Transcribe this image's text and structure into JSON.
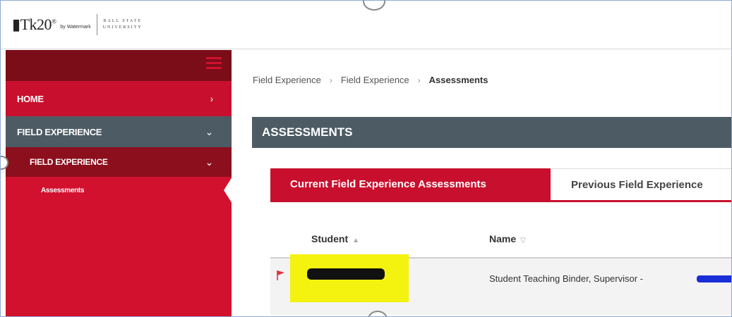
{
  "header": {
    "logo_main": "Tk20",
    "logo_by": "by Watermark",
    "university_line1": "BALL STATE",
    "university_line2": "UNIVERSITY"
  },
  "sidebar": {
    "items": [
      {
        "label": "HOME"
      },
      {
        "label": "FIELD EXPERIENCE"
      },
      {
        "label": "FIELD EXPERIENCE"
      },
      {
        "label": "Assessments"
      }
    ]
  },
  "breadcrumb": [
    "Field Experience",
    "Field Experience",
    "Assessments"
  ],
  "section": {
    "title": "ASSESSMENTS"
  },
  "tabs": [
    {
      "label": "Current Field Experience Assessments",
      "active": true
    },
    {
      "label": "Previous Field Experience",
      "active": false
    }
  ],
  "table": {
    "columns": [
      "Student",
      "Name"
    ],
    "rows": [
      {
        "student": "",
        "name": "Student Teaching Binder, Supervisor -"
      }
    ]
  },
  "colors": {
    "brand_red": "#c8102e",
    "dark_red": "#7b0d18",
    "slate": "#4d5b64",
    "highlight": "#f4f20f"
  }
}
